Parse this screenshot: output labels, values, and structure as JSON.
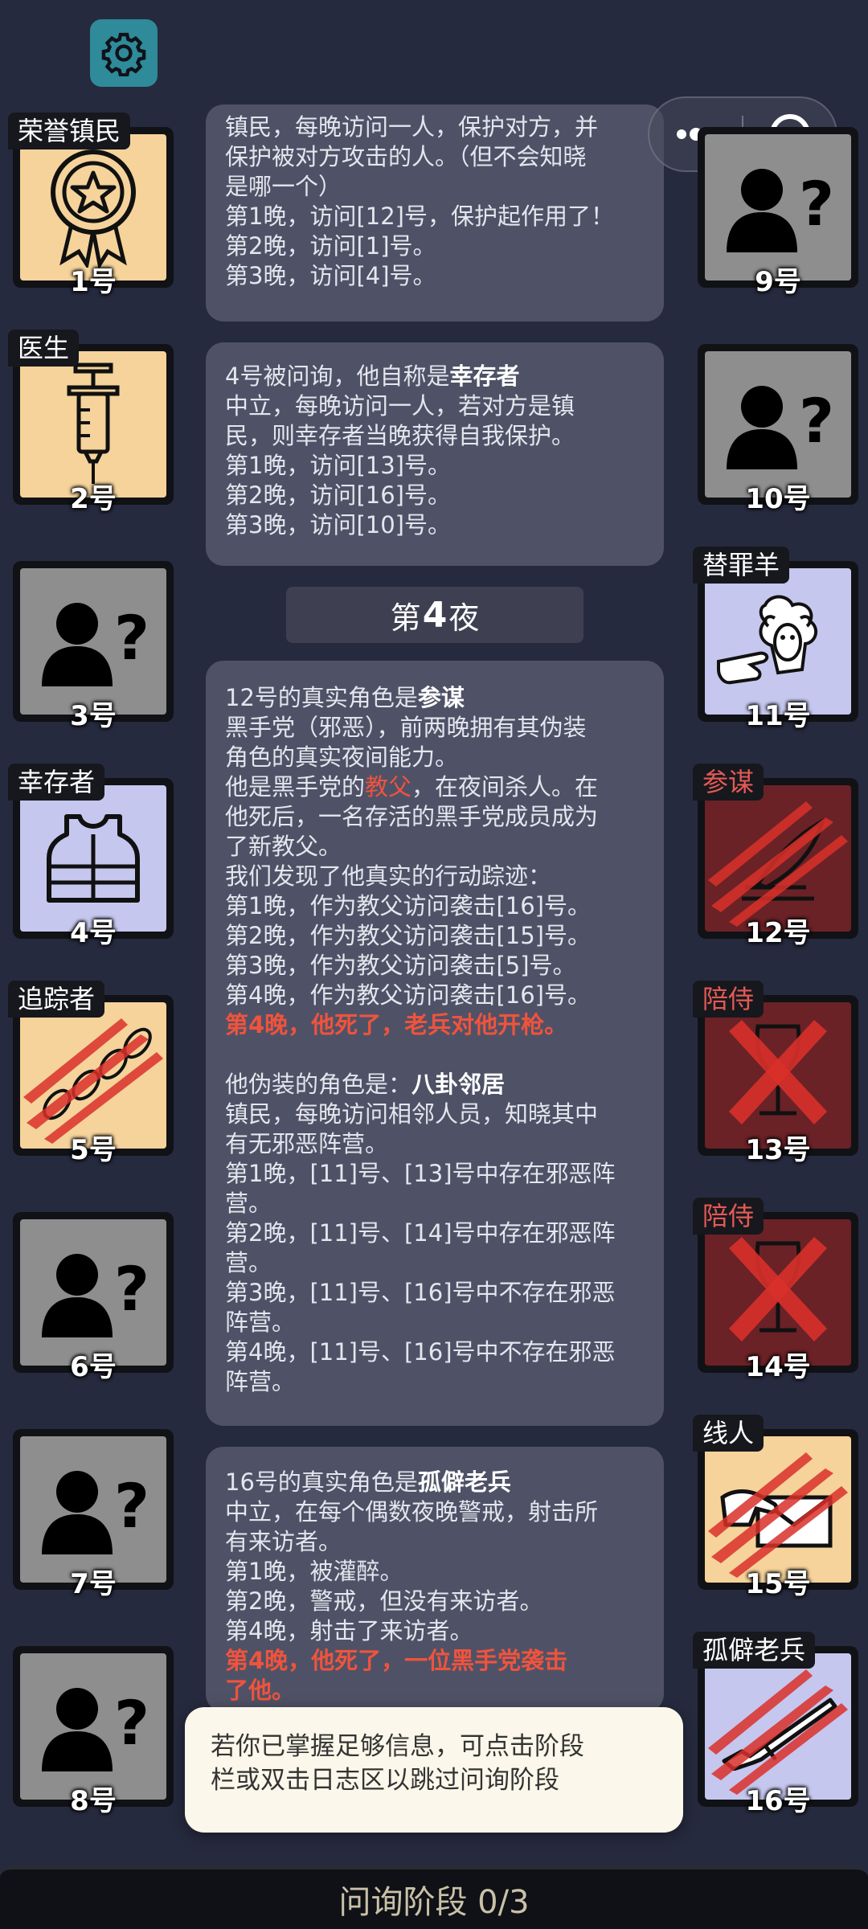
{
  "settings": {
    "icon": "gear-icon"
  },
  "capsule": {
    "more_icon": "more-dots-icon",
    "close_icon": "target-close-icon"
  },
  "players_left": [
    {
      "tag": "荣誉镇民",
      "num": "1号",
      "icon": "medal-icon",
      "bg": "orange"
    },
    {
      "tag": "医生",
      "num": "2号",
      "icon": "syringe-icon",
      "bg": "orange"
    },
    {
      "tag": "",
      "num": "3号",
      "icon": "unknown-person-icon",
      "bg": "gray"
    },
    {
      "tag": "幸存者",
      "num": "4号",
      "icon": "vest-icon",
      "bg": "lavender"
    },
    {
      "tag": "追踪者",
      "num": "5号",
      "icon": "footprints-icon",
      "bg": "orange"
    },
    {
      "tag": "",
      "num": "6号",
      "icon": "unknown-person-icon",
      "bg": "gray"
    },
    {
      "tag": "",
      "num": "7号",
      "icon": "unknown-person-icon",
      "bg": "gray"
    },
    {
      "tag": "",
      "num": "8号",
      "icon": "unknown-person-icon",
      "bg": "gray"
    }
  ],
  "players_right": [
    {
      "tag": "",
      "num": "9号",
      "icon": "unknown-person-icon",
      "bg": "gray"
    },
    {
      "tag": "",
      "num": "10号",
      "icon": "unknown-person-icon",
      "bg": "gray"
    },
    {
      "tag": "替罪羊",
      "num": "11号",
      "icon": "sheep-icon",
      "bg": "lavender"
    },
    {
      "tag": "参谋",
      "num": "12号",
      "icon": "quill-icon",
      "bg": "dark-red"
    },
    {
      "tag": "陪侍",
      "num": "13号",
      "icon": "wine-glass-crossed-icon",
      "bg": "dark-red"
    },
    {
      "tag": "陪侍",
      "num": "14号",
      "icon": "wine-glass-crossed-icon",
      "bg": "dark-red"
    },
    {
      "tag": "线人",
      "num": "15号",
      "icon": "envelope-icon",
      "bg": "orange"
    },
    {
      "tag": "孤僻老兵",
      "num": "16号",
      "icon": "rifle-icon",
      "bg": "lavender"
    }
  ],
  "log": {
    "entry1": {
      "lines": [
        "镇民，每晚访问一人，保护对方，并",
        "保护被对方攻击的人。（但不会知晓",
        "是哪一个）",
        "第1晚，访问[12]号，保护起作用了！",
        "第2晚，访问[1]号。",
        "第3晚，访问[4]号。"
      ]
    },
    "entry2": {
      "head_pre": "4号被问询，他自称是",
      "head_role": "幸存者",
      "lines": [
        "中立，每晚访问一人，若对方是镇",
        "民，则幸存者当晚获得自我保护。",
        "第1晚，访问[13]号。",
        "第2晚，访问[16]号。",
        "第3晚，访问[10]号。"
      ]
    },
    "night": {
      "pre": "第",
      "num": "4",
      "post": "夜"
    },
    "entry3": {
      "head_pre": "12号的真实角色是",
      "head_role": "参谋",
      "lines_a": [
        "黑手党（邪恶），前两晚拥有其伪装",
        "角色的真实夜间能力。"
      ],
      "godfather_pre": "他是黑手党的",
      "godfather_role": "教父",
      "godfather_post": "，在夜间杀人。在",
      "lines_b": [
        "他死后，一名存活的黑手党成员成为",
        "了新教父。",
        "我们发现了他真实的行动踪迹：",
        "第1晚，作为教父访问袭击[16]号。",
        "第2晚，作为教父访问袭击[15]号。",
        "第3晚，作为教父访问袭击[5]号。",
        "第4晚，作为教父访问袭击[16]号。"
      ],
      "death": "第4晚，他死了，老兵对他开枪。",
      "disguise_pre": "他伪装的角色是：",
      "disguise_role": "八卦邻居",
      "lines_c": [
        "镇民，每晚访问相邻人员，知晓其中",
        "有无邪恶阵营。",
        "第1晚，[11]号、[13]号中存在邪恶阵",
        "营。",
        "第2晚，[11]号、[14]号中存在邪恶阵",
        "营。",
        "第3晚，[11]号、[16]号中不存在邪恶",
        "阵营。",
        "第4晚，[11]号、[16]号中不存在邪恶",
        "阵营。"
      ]
    },
    "entry4": {
      "head_pre": "16号的真实角色是",
      "head_role": "孤僻老兵",
      "lines": [
        "中立，在每个偶数夜晚警戒，射击所",
        "有来访者。",
        "第1晚，被灌醉。",
        "第2晚，警戒，但没有来访者。",
        "第4晚，射击了来访者。"
      ],
      "death_1": "第4晚，他死了，一位黑手党袭击",
      "death_2": "了他。"
    }
  },
  "toast": {
    "line1": "若你已掌握足够信息，可点击阶段",
    "line2": "栏或双击日志区以跳过问询阶段"
  },
  "phase": {
    "label": "问询阶段 0/3"
  },
  "colors": {
    "background": "#262a3e",
    "bubble": "#4f5266",
    "highlight_red": "#f0533d",
    "card_orange": "#f5d39b",
    "card_gray": "#8e8e8f",
    "card_lavender": "#c5c7ee",
    "card_dark_red": "#6a2227"
  }
}
